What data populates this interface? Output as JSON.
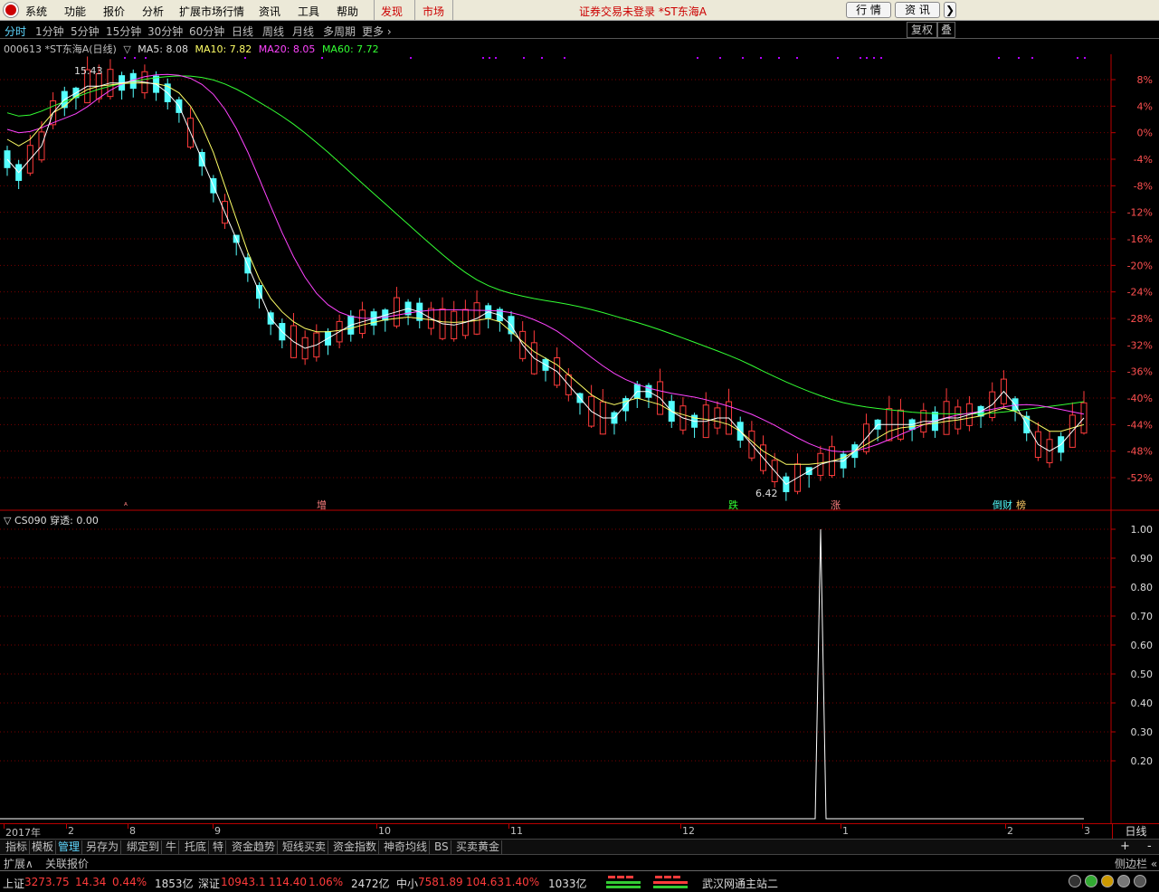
{
  "menubar": {
    "items": [
      "系统",
      "功能",
      "报价",
      "分析",
      "扩展市场行情",
      "资讯",
      "工具",
      "帮助"
    ],
    "highlight_items": [
      "发现",
      "市场"
    ],
    "status": "证券交易未登录  *ST东海A",
    "buttons": [
      "行 情",
      "资 讯",
      "❯"
    ]
  },
  "periods": {
    "items": [
      "分时",
      "1分钟",
      "5分钟",
      "15分钟",
      "30分钟",
      "60分钟",
      "日线",
      "周线",
      "月线",
      "多周期",
      "更多 ›"
    ],
    "active": "分时",
    "right_buttons": [
      "复权",
      "叠加"
    ]
  },
  "info": {
    "code_name": "000613 *ST东海A(日线)",
    "toggle": "▽",
    "ma5": "MA5: 8.08",
    "ma10": "MA10: 7.82",
    "ma20": "MA20: 8.05",
    "ma60": "MA60: 7.72"
  },
  "colors": {
    "up": "#ff3b3b",
    "down": "#54ffff",
    "ma5": "#ffffff",
    "ma10": "#ffff66",
    "ma20": "#ff44ff",
    "ma60": "#33ff33",
    "grid": "#7a0000"
  },
  "chart_data": [
    {
      "type": "candlestick",
      "title": "000613 *ST东海A(日线)",
      "y_axis_percent_labels": [
        "8%",
        "4%",
        "0%",
        "-4%",
        "-8%",
        "-12%",
        "-16%",
        "-20%",
        "-24%",
        "-28%",
        "-32%",
        "-36%",
        "-40%",
        "-44%",
        "-48%",
        "-52%"
      ],
      "ylim_pct": [
        -54,
        10
      ],
      "high_marker": "15.43",
      "low_marker": "6.42",
      "event_labels": [
        "增",
        "跌",
        "涨",
        "倒财",
        "榜"
      ],
      "ma5_pct": [
        -4,
        -6,
        -4,
        -2,
        3,
        5,
        6,
        7,
        7,
        7.5,
        7.5,
        7.8,
        7.6,
        7.3,
        6,
        4,
        0,
        -4,
        -8,
        -12,
        -16,
        -20,
        -24,
        -28,
        -30,
        -31.5,
        -32.5,
        -32,
        -31,
        -30,
        -29,
        -28.5,
        -28,
        -27.5,
        -27,
        -26.5,
        -27,
        -28,
        -28.8,
        -29,
        -28.6,
        -28,
        -27,
        -27.5,
        -29,
        -32,
        -34,
        -35,
        -36,
        -38,
        -40,
        -42,
        -43,
        -43,
        -41,
        -39,
        -39,
        -40,
        -42,
        -43,
        -43.5,
        -43.5,
        -43,
        -43,
        -45,
        -47,
        -49,
        -51,
        -53,
        -52,
        -51,
        -50,
        -49.5,
        -49.5,
        -48,
        -46,
        -44,
        -44,
        -44,
        -44,
        -43.5,
        -43.5,
        -43,
        -43,
        -42.5,
        -42,
        -41,
        -39,
        -41,
        -44,
        -47,
        -48,
        -47,
        -45,
        -43
      ],
      "ma10_pct": [
        -1,
        -2,
        -1,
        1,
        3,
        4,
        5.5,
        6.5,
        7,
        7.2,
        7.4,
        7.5,
        7.5,
        7.4,
        7,
        6,
        4,
        1,
        -3,
        -8,
        -13,
        -18,
        -22,
        -25,
        -27,
        -28.5,
        -29.5,
        -30,
        -30,
        -29.8,
        -29.5,
        -29,
        -28.6,
        -28.2,
        -28,
        -27.8,
        -28,
        -28.2,
        -28.5,
        -28.6,
        -28.5,
        -28.3,
        -28,
        -28.5,
        -30,
        -31.5,
        -33,
        -34,
        -35,
        -36.5,
        -38,
        -39.5,
        -40.5,
        -41,
        -40.5,
        -40,
        -40.5,
        -41,
        -42,
        -42.5,
        -43,
        -43.2,
        -43.5,
        -44,
        -45,
        -46.5,
        -48,
        -49,
        -50,
        -50,
        -50,
        -49.8,
        -49.5,
        -49,
        -48,
        -47,
        -46,
        -45,
        -44.5,
        -44.3,
        -44,
        -43.8,
        -43.5,
        -43.3,
        -43,
        -42.7,
        -42,
        -41.5,
        -42,
        -43,
        -44,
        -45,
        -45,
        -44.5,
        -44
      ]
    },
    {
      "type": "line",
      "title": "CS090",
      "indicator_name": "CS090",
      "value_label": "穿透: 0.00",
      "y_tick_labels": [
        "1.00",
        "0.90",
        "0.80",
        "0.70",
        "0.60",
        "0.50",
        "0.40",
        "0.30",
        "0.20"
      ],
      "ylim": [
        0,
        1.0
      ],
      "spike_value": 1.0
    }
  ],
  "time_axis": [
    "2017年",
    "2",
    "8",
    "9",
    "10",
    "11",
    "12",
    "1",
    "2",
    "3"
  ],
  "time_axis_right": "日线",
  "tabs1": [
    "指标",
    "模板",
    "管理",
    "另存为",
    "绑定到",
    "牛",
    "托底",
    "特",
    "资金趋势",
    "短线买卖",
    "资金指数",
    "神奇均线",
    "BS",
    "买卖黄金"
  ],
  "tabs1_selected": "管理",
  "tabs1_right": [
    "+",
    "-"
  ],
  "tabs2": [
    "扩展∧",
    "关联报价"
  ],
  "tabs2_right": "侧边栏 «",
  "status": {
    "sh_label": "上证",
    "sh_value": "3273.75",
    "sh_change": "14.34",
    "sh_pct": "0.44%",
    "sh_vol": "1853亿",
    "sz_label": "深证",
    "sz_value": "10943.1",
    "sz_change": "114.40",
    "sz_pct": "1.06%",
    "sz_vol": "2472亿",
    "zx_label": "中小",
    "zx_value": "7581.89",
    "zx_change": "104.63",
    "zx_pct": "1.40%",
    "zx_vol": "1033亿",
    "server": "武汉网通主站二"
  }
}
